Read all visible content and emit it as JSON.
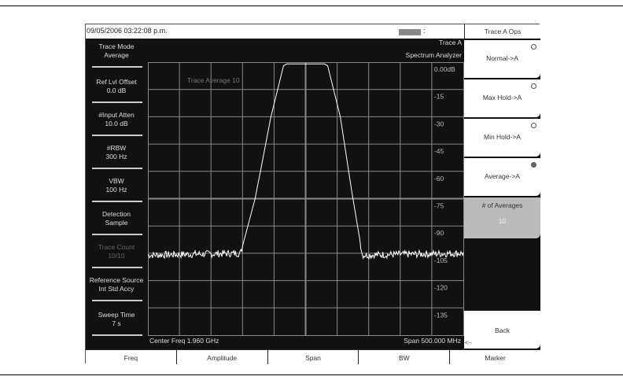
{
  "timestamp": "09/05/2006 03:22:08 p.m.",
  "status_colon": ":",
  "header": {
    "trace": "Trace A",
    "mode": "Spectrum Analyzer"
  },
  "left_panel": [
    {
      "title": "Trace Mode",
      "value": "Average",
      "dim": false
    },
    {
      "title": "Ref Lvl Offset",
      "value": "0.0 dB",
      "dim": false
    },
    {
      "title": "#Input Atten",
      "value": "10.0 dB",
      "dim": false
    },
    {
      "title": "#RBW",
      "value": "300 Hz",
      "dim": false
    },
    {
      "title": "VBW",
      "value": "100 Hz",
      "dim": false
    },
    {
      "title": "Detection",
      "value": "Sample",
      "dim": false
    },
    {
      "title": "Trace Count",
      "value": "10/10",
      "dim": true
    },
    {
      "title": "Reference Source",
      "value": "Int Std Accy",
      "dim": false
    },
    {
      "title": "Sweep Time",
      "value": "7 s",
      "dim": false
    }
  ],
  "graph": {
    "annotation": "Trace Average  10",
    "y_labels": [
      "0.00dB",
      "-15",
      "-30",
      "-45",
      "-60",
      "-75",
      "-90",
      "-105",
      "-120",
      "-135"
    ],
    "center_freq": "Center Freq 1.960 GHz",
    "span": "Span 500.000 MHz",
    "trace_color": "#ffffff",
    "grid_color": "#888888"
  },
  "chart_data": {
    "type": "line",
    "x_unit": "MHz",
    "y_unit": "dB",
    "xlim": [
      1710,
      2210
    ],
    "ylim": [
      -150,
      0
    ],
    "points": [
      [
        1710,
        -106
      ],
      [
        1857,
        -105
      ],
      [
        1880,
        -75
      ],
      [
        1905,
        -30
      ],
      [
        1925,
        -2
      ],
      [
        1930,
        -1
      ],
      [
        1990,
        -1
      ],
      [
        1995,
        -2
      ],
      [
        2015,
        -30
      ],
      [
        2035,
        -75
      ],
      [
        2050,
        -106
      ],
      [
        2210,
        -105
      ]
    ],
    "grid": true
  },
  "softkeys": {
    "title": "Trace A Ops",
    "items": [
      {
        "label": "Normal->A",
        "radio": "off"
      },
      {
        "label": "Max Hold->A",
        "radio": "off"
      },
      {
        "label": "Min Hold->A",
        "radio": "off"
      },
      {
        "label": "Average->A",
        "radio": "on"
      }
    ],
    "averages_label": "# of Averages",
    "averages_value": "10",
    "back": "Back",
    "back_arrow": "<--"
  },
  "tabs": [
    "Freq",
    "Amplitude",
    "Span",
    "BW",
    "Marker"
  ]
}
